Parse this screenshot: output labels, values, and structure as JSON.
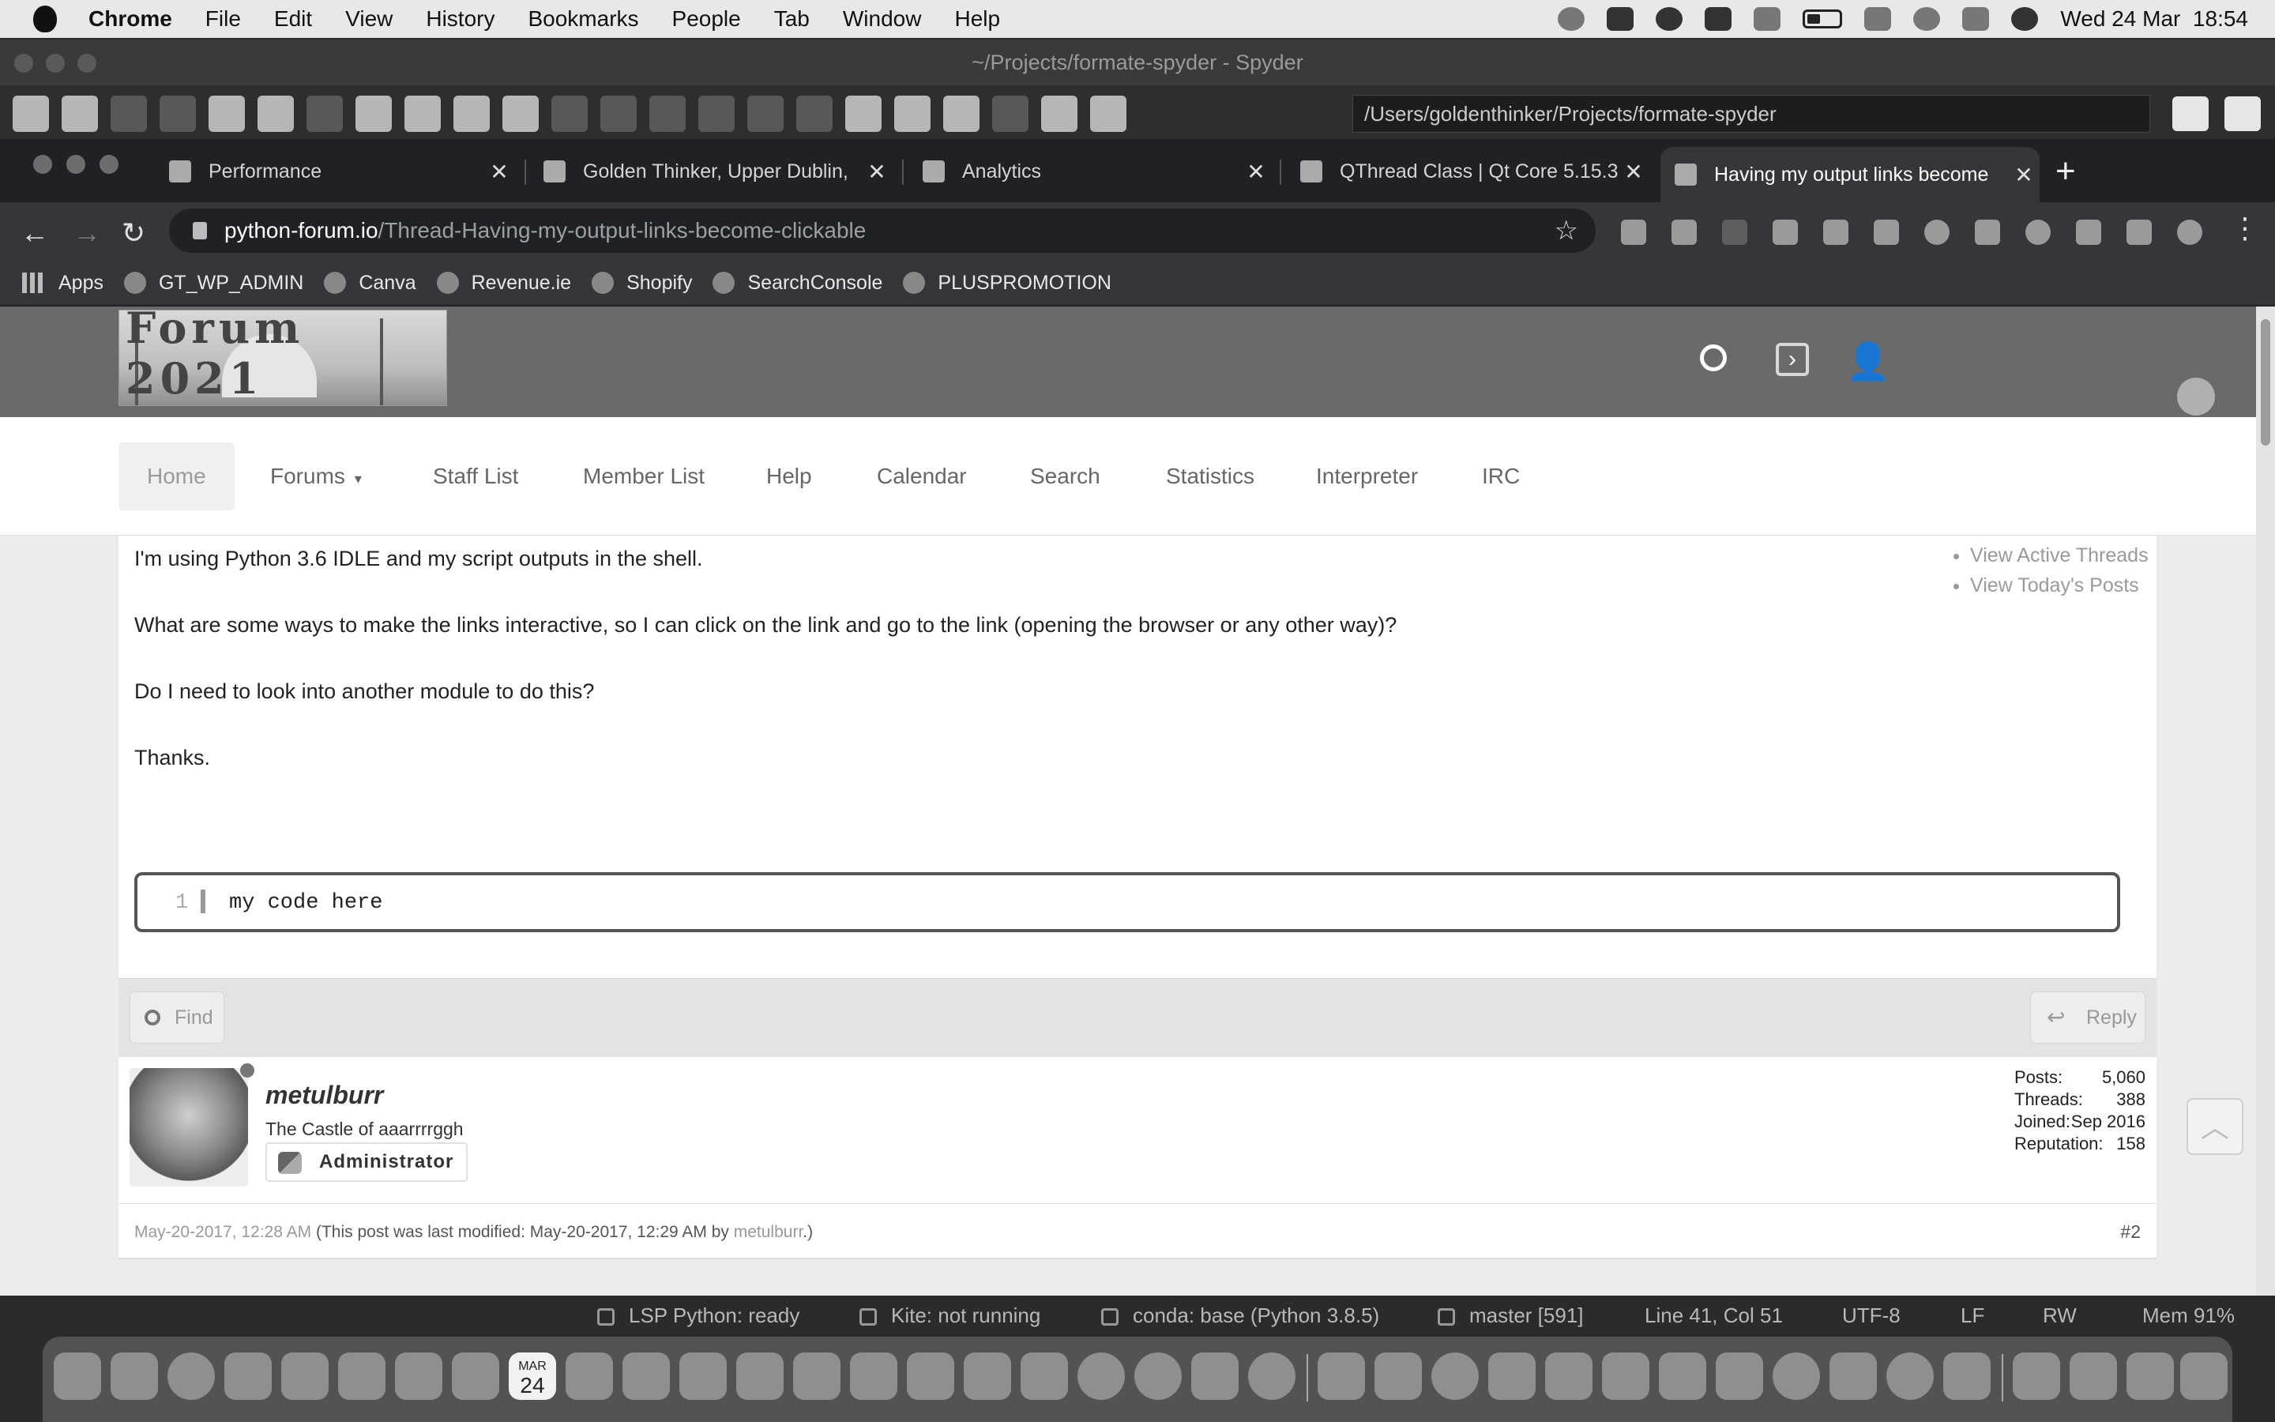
{
  "menubar": {
    "app": "Chrome",
    "items": [
      "File",
      "Edit",
      "View",
      "History",
      "Bookmarks",
      "People",
      "Tab",
      "Window",
      "Help"
    ],
    "datetime": "Wed 24 Mar  18:54"
  },
  "spyder": {
    "title": "~/Projects/formate-spyder - Spyder",
    "path": "/Users/goldenthinker/Projects/formate-spyder",
    "status": {
      "lsp": "LSP Python: ready",
      "kite": "Kite: not running",
      "conda": "conda: base (Python 3.8.5)",
      "git": "master [591]",
      "cursor": "Line 41, Col 51",
      "encoding": "UTF-8",
      "eol": "LF",
      "mode": "RW",
      "memory": "Mem 91%"
    }
  },
  "chrome": {
    "tabs": [
      {
        "label": "Performance"
      },
      {
        "label": "Golden Thinker, Upper Dublin,"
      },
      {
        "label": "Analytics"
      },
      {
        "label": "QThread Class | Qt Core 5.15.3"
      },
      {
        "label": "Having my output links become"
      }
    ],
    "close_glyph": "✕",
    "new_tab": "+",
    "url_host": "python-forum.io",
    "url_path": "/Thread-Having-my-output-links-become-clickable",
    "bookmarks": [
      "Apps",
      "GT_WP_ADMIN",
      "Canva",
      "Revenue.ie",
      "Shopify",
      "SearchConsole",
      "PLUSPROMOTION"
    ]
  },
  "site": {
    "logo_text": "Forum 2021",
    "nav": [
      "Home",
      "Forums",
      "Staff List",
      "Member List",
      "Help",
      "Calendar",
      "Search",
      "Statistics",
      "Interpreter",
      "IRC"
    ],
    "side_links": [
      "View Active Threads",
      "View Today's Posts"
    ]
  },
  "post": {
    "lines": [
      "I'm using Python 3.6 IDLE and my script outputs in the shell.",
      "What are some ways to make the links interactive, so I can click on the link and go to the link (opening the browser or any other way)?",
      "Do I need to look into another module to do this?",
      "Thanks."
    ],
    "code_line_number": "1",
    "code": "my code here",
    "find_label": "Find",
    "reply_label": "Reply"
  },
  "author": {
    "name": "metulburr",
    "title": "The Castle of aaarrrrggh",
    "group": "Administrator",
    "stats": [
      {
        "label": "Posts:",
        "value": "5,060"
      },
      {
        "label": "Threads:",
        "value": "388"
      },
      {
        "label": "Joined:",
        "value": "Sep 2016"
      },
      {
        "label": "Reputation:",
        "value": "158"
      }
    ]
  },
  "meta": {
    "date": "May-20-2017, 12:28 AM",
    "edited_prefix": "(This post was last modified: May-20-2017, 12:29 AM by ",
    "edited_user": "metulburr",
    "edited_suffix": ".)",
    "post_number": "#2"
  },
  "dock": {
    "calendar_month": "MAR",
    "calendar_day": "24"
  }
}
